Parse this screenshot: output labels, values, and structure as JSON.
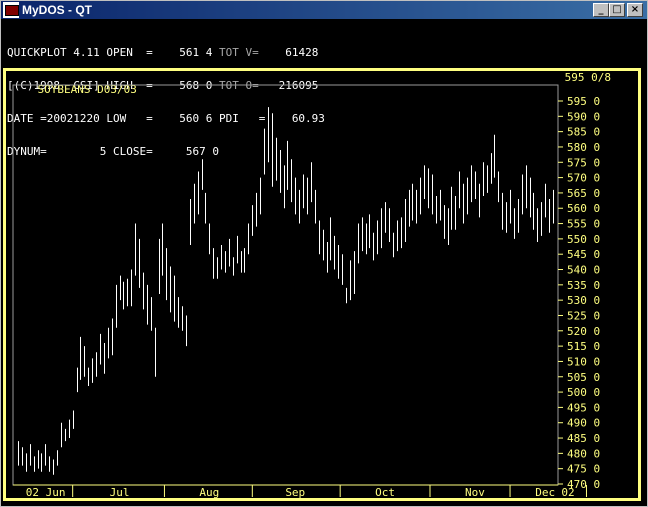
{
  "window": {
    "title": "MyDOS - QT",
    "buttons": {
      "minimize": "_",
      "maximize": "□",
      "close": "×"
    }
  },
  "info": {
    "row1": {
      "left": "QUICKPLOT 4.11",
      "key": "OPEN  =",
      "val": "561 4",
      "tk": "TOT V=",
      "tv": "61428"
    },
    "row2": {
      "left": "[(C)1998  CSI]",
      "key": "HIGH  =",
      "val": "568 0",
      "tk": "TOT O=",
      "tv": "216095"
    },
    "row3": {
      "left": "DATE =20021220",
      "key": "LOW   =",
      "val": "560 6",
      "tk": "PDI   =",
      "tv": "60.93"
    },
    "row4": {
      "left": "DYNUM=        5",
      "key": "CLOSE=",
      "val": "567 0",
      "tk": "",
      "tv": ""
    }
  },
  "chart_header": {
    "symbol": "SOYBEANS D03/03",
    "last": "595 0/8"
  },
  "colors": {
    "frame": "#ffff80",
    "bars": "#ffffff",
    "axis": "#ffff80",
    "background": "#000000"
  },
  "chart_data": {
    "type": "ohlc-bar",
    "title": "SOYBEANS D03/03",
    "ylim": [
      470,
      595
    ],
    "y_tick_labels": [
      "595 0",
      "590 0",
      "585 0",
      "580 0",
      "575 0",
      "570 0",
      "565 0",
      "560 0",
      "555 0",
      "550 0",
      "545 0",
      "540 0",
      "535 0",
      "530 0",
      "525 0",
      "520 0",
      "515 0",
      "510 0",
      "505 0",
      "500 0",
      "495 0",
      "490 0",
      "485 0",
      "480 0",
      "475 0",
      "470 0"
    ],
    "x_labels": [
      "02 Jun",
      "Jul",
      "Aug",
      "Sep",
      "Oct",
      "Nov",
      "Dec",
      "02"
    ],
    "x_label_index": [
      2,
      26,
      49,
      71,
      94,
      117,
      135,
      150
    ],
    "bars": [
      [
        484,
        476
      ],
      [
        482,
        476
      ],
      [
        480,
        474
      ],
      [
        483,
        476
      ],
      [
        479,
        474
      ],
      [
        481,
        475
      ],
      [
        480,
        474
      ],
      [
        483,
        476
      ],
      [
        479,
        474
      ],
      [
        478,
        473
      ],
      [
        481,
        476
      ],
      [
        490,
        482
      ],
      [
        488,
        484
      ],
      [
        491,
        485
      ],
      [
        494,
        488
      ],
      [
        508,
        500
      ],
      [
        518,
        504
      ],
      [
        515,
        505
      ],
      [
        508,
        502
      ],
      [
        511,
        503
      ],
      [
        513,
        505
      ],
      [
        519,
        509
      ],
      [
        516,
        506
      ],
      [
        521,
        511
      ],
      [
        524,
        512
      ],
      [
        535,
        521
      ],
      [
        538,
        530
      ],
      [
        536,
        527
      ],
      [
        537,
        528
      ],
      [
        540,
        528
      ],
      [
        555,
        538
      ],
      [
        550,
        534
      ],
      [
        539,
        527
      ],
      [
        535,
        522
      ],
      [
        531,
        520
      ],
      [
        521,
        505
      ],
      [
        550,
        532
      ],
      [
        555,
        538
      ],
      [
        547,
        530
      ],
      [
        541,
        526
      ],
      [
        538,
        523
      ],
      [
        531,
        521
      ],
      [
        528,
        520
      ],
      [
        525,
        515
      ],
      [
        563,
        548
      ],
      [
        568,
        555
      ],
      [
        572,
        558
      ],
      [
        576,
        566
      ],
      [
        565,
        555
      ],
      [
        555,
        545
      ],
      [
        547,
        537
      ],
      [
        544,
        537
      ],
      [
        548,
        540
      ],
      [
        546,
        539
      ],
      [
        550,
        541
      ],
      [
        544,
        538
      ],
      [
        551,
        542
      ],
      [
        546,
        539
      ],
      [
        547,
        539
      ],
      [
        555,
        545
      ],
      [
        561,
        551
      ],
      [
        565,
        554
      ],
      [
        570,
        558
      ],
      [
        586,
        571
      ],
      [
        593,
        575
      ],
      [
        591,
        567
      ],
      [
        583,
        569
      ],
      [
        579,
        565
      ],
      [
        574,
        560
      ],
      [
        582,
        566
      ],
      [
        576,
        562
      ],
      [
        570,
        558
      ],
      [
        566,
        555
      ],
      [
        571,
        560
      ],
      [
        570,
        558
      ],
      [
        575,
        562
      ],
      [
        566,
        555
      ],
      [
        556,
        545
      ],
      [
        553,
        543
      ],
      [
        549,
        539
      ],
      [
        557,
        543
      ],
      [
        551,
        540
      ],
      [
        548,
        537
      ],
      [
        545,
        535
      ],
      [
        534,
        529
      ],
      [
        543,
        530
      ],
      [
        546,
        532
      ],
      [
        555,
        542
      ],
      [
        557,
        546
      ],
      [
        555,
        545
      ],
      [
        558,
        547
      ],
      [
        552,
        543
      ],
      [
        556,
        545
      ],
      [
        560,
        547
      ],
      [
        562,
        552
      ],
      [
        560,
        549
      ],
      [
        552,
        544
      ],
      [
        556,
        546
      ],
      [
        557,
        547
      ],
      [
        563,
        549
      ],
      [
        566,
        554
      ],
      [
        568,
        556
      ],
      [
        566,
        555
      ],
      [
        570,
        558
      ],
      [
        574,
        563
      ],
      [
        573,
        560
      ],
      [
        571,
        558
      ],
      [
        564,
        555
      ],
      [
        566,
        556
      ],
      [
        561,
        550
      ],
      [
        560,
        548
      ],
      [
        567,
        553
      ],
      [
        564,
        553
      ],
      [
        572,
        560
      ],
      [
        568,
        555
      ],
      [
        570,
        558
      ],
      [
        574,
        562
      ],
      [
        572,
        563
      ],
      [
        568,
        557
      ],
      [
        575,
        564
      ],
      [
        574,
        565
      ],
      [
        578,
        568
      ],
      [
        584,
        570
      ],
      [
        572,
        562
      ],
      [
        565,
        553
      ],
      [
        562,
        552
      ],
      [
        566,
        555
      ],
      [
        560,
        550
      ],
      [
        563,
        552
      ],
      [
        571,
        558
      ],
      [
        574,
        560
      ],
      [
        570,
        557
      ],
      [
        565,
        553
      ],
      [
        560,
        549
      ],
      [
        562,
        551
      ],
      [
        568,
        557
      ],
      [
        563,
        552
      ],
      [
        566,
        555
      ]
    ]
  }
}
